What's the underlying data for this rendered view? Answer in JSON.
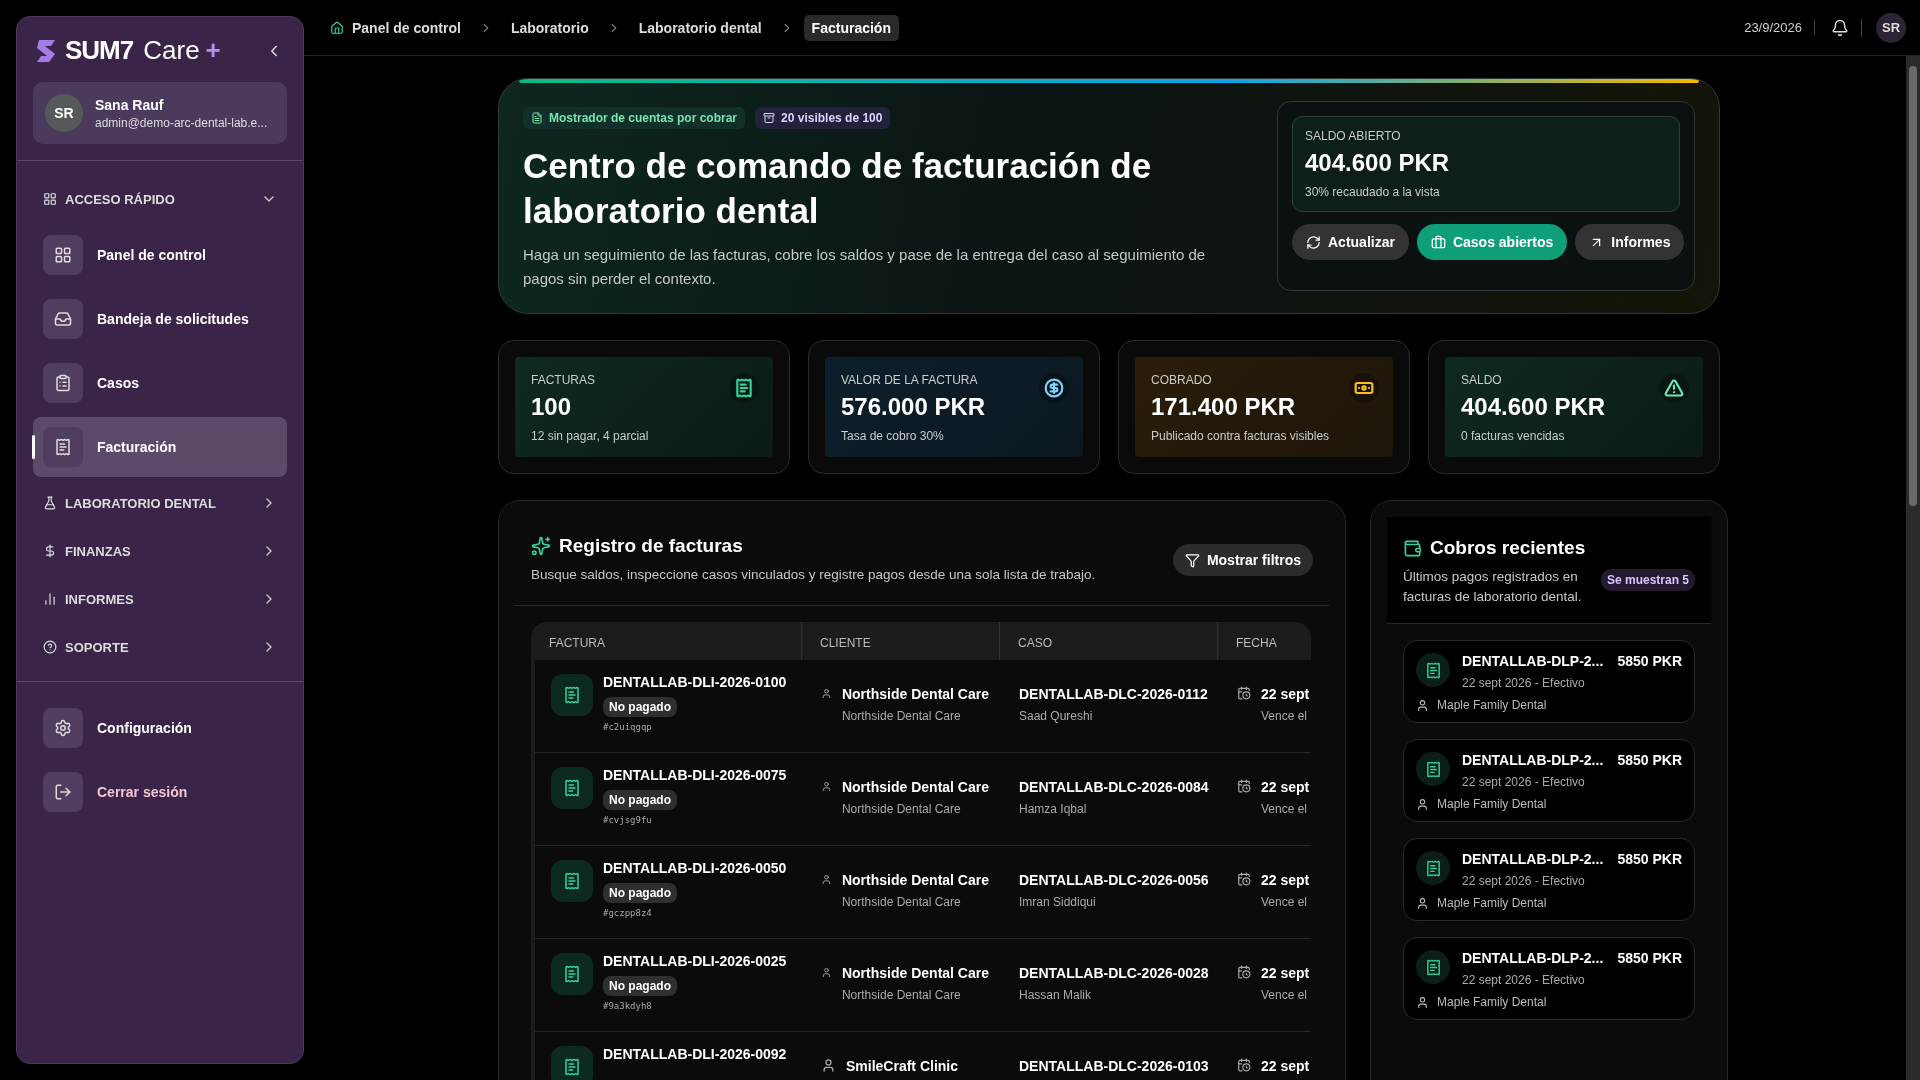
{
  "sidebar": {
    "logo": {
      "brand": "SUM7",
      "product": "Care",
      "plus": "+"
    },
    "user": {
      "initials": "SR",
      "name": "Sana Rauf",
      "email": "admin@demo-arc-dental-lab.e..."
    },
    "groups": [
      {
        "label": "ACCESO RÁPIDO",
        "expanded": true,
        "items": [
          {
            "label": "Panel de control",
            "selected": false
          },
          {
            "label": "Bandeja de solicitudes",
            "selected": false
          },
          {
            "label": "Casos",
            "selected": false
          },
          {
            "label": "Facturación",
            "selected": true
          }
        ]
      },
      {
        "label": "LABORATORIO DENTAL",
        "expanded": false
      },
      {
        "label": "FINANZAS",
        "expanded": false
      },
      {
        "label": "INFORMES",
        "expanded": false
      },
      {
        "label": "SOPORTE",
        "expanded": false
      }
    ],
    "footer": [
      {
        "label": "Configuración",
        "kind": "settings"
      },
      {
        "label": "Cerrar sesión",
        "kind": "logout"
      }
    ]
  },
  "topbar": {
    "breadcrumbs": [
      {
        "label": "Panel de control",
        "selected": false
      },
      {
        "label": "Laboratorio",
        "selected": false
      },
      {
        "label": "Laboratorio dental",
        "selected": false
      },
      {
        "label": "Facturación",
        "selected": true
      }
    ],
    "date": "23/9/2026",
    "avatar": "SR"
  },
  "hero": {
    "tags": [
      "Mostrador de cuentas por cobrar",
      "20 visibles de 100"
    ],
    "title": "Centro de comando de facturación de laboratorio dental",
    "description": "Haga un seguimiento de las facturas, cobre los saldos y pase de la entrega del caso al seguimiento de pagos sin perder el contexto.",
    "balance": {
      "label": "SALDO ABIERTO",
      "value": "404.600 PKR",
      "note": "30% recaudado a la vista"
    },
    "buttons": [
      {
        "label": "Actualizar",
        "kind": "secondary"
      },
      {
        "label": "Casos abiertos",
        "kind": "primary"
      },
      {
        "label": "Informes",
        "kind": "secondary"
      }
    ]
  },
  "stats": [
    {
      "label": "FACTURAS",
      "value": "100",
      "note": "12 sin pagar, 4 parcial",
      "color": "#34d399"
    },
    {
      "label": "VALOR DE LA FACTURA",
      "value": "576.000 PKR",
      "note": "Tasa de cobro 30%",
      "color": "#7dd3fc"
    },
    {
      "label": "COBRADO",
      "value": "171.400 PKR",
      "note": "Publicado contra facturas visibles",
      "color": "#fbbf24"
    },
    {
      "label": "SALDO",
      "value": "404.600 PKR",
      "note": "0 facturas vencidas",
      "color": "#6ee7b7"
    }
  ],
  "register": {
    "title": "Registro de facturas",
    "description": "Busque saldos, inspeccione casos vinculados y registre pagos desde una sola lista de trabajo.",
    "filter_button": "Mostrar filtros",
    "columns": [
      "FACTURA",
      "CLIENTE",
      "CASO",
      "FECHA"
    ],
    "rows": [
      {
        "invoice": "DENTALLAB-DLI-2026-0100",
        "status": "No pagado",
        "code": "#c2uiqgqp",
        "client": "Northside Dental Care",
        "client_sub": "Northside Dental Care",
        "case": "DENTALLAB-DLC-2026-0112",
        "patient": "Saad Qureshi",
        "date": "22 sept",
        "due": "Vence el"
      },
      {
        "invoice": "DENTALLAB-DLI-2026-0075",
        "status": "No pagado",
        "code": "#cvjsg9fu",
        "client": "Northside Dental Care",
        "client_sub": "Northside Dental Care",
        "case": "DENTALLAB-DLC-2026-0084",
        "patient": "Hamza Iqbal",
        "date": "22 sept",
        "due": "Vence el"
      },
      {
        "invoice": "DENTALLAB-DLI-2026-0050",
        "status": "No pagado",
        "code": "#gczpp8z4",
        "client": "Northside Dental Care",
        "client_sub": "Northside Dental Care",
        "case": "DENTALLAB-DLC-2026-0056",
        "patient": "Imran Siddiqui",
        "date": "22 sept",
        "due": "Vence el"
      },
      {
        "invoice": "DENTALLAB-DLI-2026-0025",
        "status": "No pagado",
        "code": "#9a3kdyh8",
        "client": "Northside Dental Care",
        "client_sub": "Northside Dental Care",
        "case": "DENTALLAB-DLC-2026-0028",
        "patient": "Hassan Malik",
        "date": "22 sept",
        "due": "Vence el"
      },
      {
        "invoice": "DENTALLAB-DLI-2026-0092",
        "client": "SmileCraft Clinic",
        "case": "DENTALLAB-DLC-2026-0103",
        "date": "22 sept"
      }
    ]
  },
  "recent": {
    "title": "Cobros recientes",
    "description": "Últimos pagos registrados en facturas de laboratorio dental.",
    "badge": "Se muestran 5",
    "payments": [
      {
        "ref": "DENTALLAB-DLP-2...",
        "amount": "5850 PKR",
        "meta": "22 sept 2026 - Efectivo",
        "client": "Maple Family Dental"
      },
      {
        "ref": "DENTALLAB-DLP-2...",
        "amount": "5850 PKR",
        "meta": "22 sept 2026 - Efectivo",
        "client": "Maple Family Dental"
      },
      {
        "ref": "DENTALLAB-DLP-2...",
        "amount": "5850 PKR",
        "meta": "22 sept 2026 - Efectivo",
        "client": "Maple Family Dental"
      },
      {
        "ref": "DENTALLAB-DLP-2...",
        "amount": "5850 PKR",
        "meta": "22 sept 2026 - Efectivo",
        "client": "Maple Family Dental"
      }
    ]
  }
}
